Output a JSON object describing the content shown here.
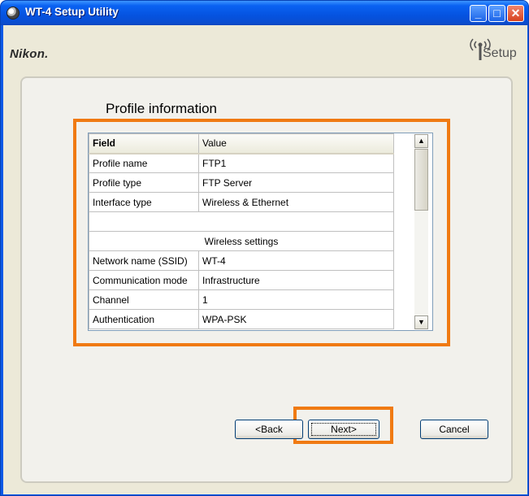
{
  "window": {
    "title": "WT-4 Setup Utility",
    "brand": "Nikon.",
    "setup_logo_text": "Setup"
  },
  "page": {
    "title": "Profile information"
  },
  "table": {
    "headers": [
      "Field",
      "Value"
    ],
    "rows": [
      {
        "field": "Profile name",
        "value": "FTP1"
      },
      {
        "field": "Profile type",
        "value": "FTP Server"
      },
      {
        "field": "Interface type",
        "value": "Wireless & Ethernet"
      },
      {
        "field": "",
        "value": ""
      },
      {
        "section": "Wireless settings"
      },
      {
        "field": "Network name (SSID)",
        "value": "WT-4"
      },
      {
        "field": "Communication mode",
        "value": "Infrastructure"
      },
      {
        "field": "Channel",
        "value": "1"
      },
      {
        "field": "Authentication",
        "value": "WPA-PSK"
      }
    ]
  },
  "buttons": {
    "back": "<Back",
    "next": "Next>",
    "cancel": "Cancel"
  },
  "colors": {
    "highlight": "#F07A12",
    "titlebar": "#0553E0",
    "face": "#ECE9D8"
  },
  "icons": [
    "app-icon",
    "minimize-icon",
    "maximize-icon",
    "close-icon",
    "wireless-setup-icon",
    "scroll-up-icon",
    "scroll-down-icon"
  ]
}
